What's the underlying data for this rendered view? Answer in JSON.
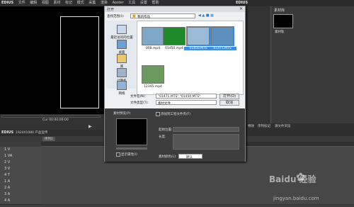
{
  "app": {
    "logo": "EDIUS",
    "menu": [
      "文件",
      "编辑",
      "视图",
      "素材",
      "标记",
      "模式",
      "采集",
      "渲染",
      "Aoster",
      "工具",
      "设置",
      "帮助"
    ],
    "right_panel_logo": "EDIUS",
    "right_panel_title": "素材库",
    "bin_clip_label": "素材轨",
    "timecode": "Cur 00:00:00:00",
    "bin_tabs": [
      "素材库",
      "特效",
      "序列标记",
      "源文件浏览"
    ],
    "tl_left_label": "EDIUS",
    "tl_project": "1920X1080 产品宣传",
    "tl_seq_tab": "序列1",
    "tracks": [
      "1 V",
      "1 VA",
      "2 V",
      "3 V",
      "4 T",
      "1 A",
      "2 A",
      "3 A",
      "4 A"
    ]
  },
  "dialog": {
    "title": "打开",
    "lookin_label": "查找范围(I):",
    "lookin_value": "我的作品",
    "nav": [
      "最近访问的位置",
      "桌面",
      "库",
      "计算机",
      "网络"
    ],
    "files": [
      {
        "name": "008.mp4",
        "selected": false
      },
      {
        "name": "01450.mp4",
        "selected": false
      },
      {
        "name": "01450.MTS",
        "selected": true
      },
      {
        "name": "01471.MTS",
        "selected": true
      },
      {
        "name": "12345.mp4",
        "selected": false
      }
    ],
    "filename_label": "文件名(N):",
    "filename_value": "\"01471.MTS\" \"01450.MTS\"",
    "filetype_label": "文件类型(T):",
    "filetype_value": "素材文件",
    "open_button": "打开(O)",
    "cancel_button": "取消",
    "preview_label": "素材预览(P)",
    "checkbox_label": "添加到工程文件夹(F)",
    "checkbox_label2": "显示属性(I)",
    "start_label": "起始位置:",
    "length_label": "长度:",
    "clip_color_label": "素材颜色(L):",
    "clip_color_value": "默认"
  },
  "watermark": {
    "text": "Baidu 经验",
    "url": "jingyan.baidu.com"
  }
}
